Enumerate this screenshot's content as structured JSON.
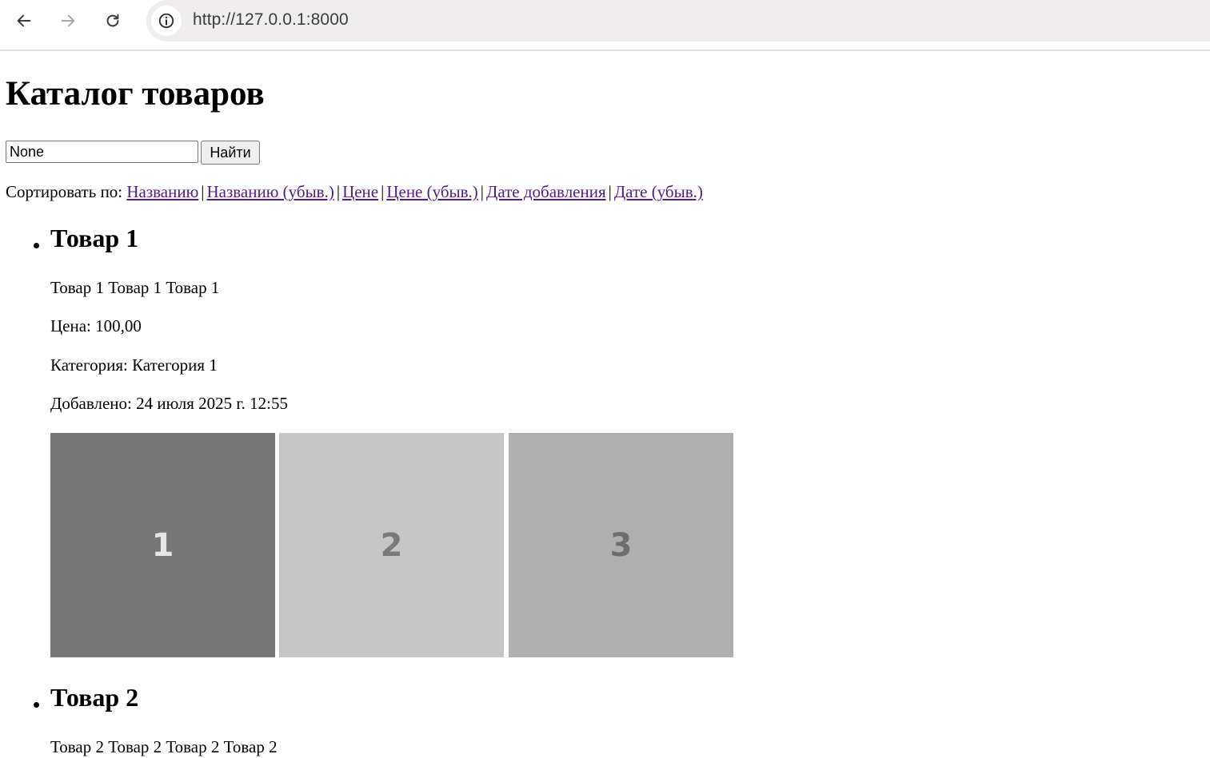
{
  "browser": {
    "url": "http://127.0.0.1:8000"
  },
  "page": {
    "title": "Каталог товаров"
  },
  "search": {
    "value": "None",
    "button_label": "Найти"
  },
  "sort": {
    "label": "Сортировать по:",
    "links": [
      "Названию",
      "Названию (убыв.)",
      "Цене",
      "Цене (убыв.)",
      "Дате добавления",
      "Дате (убыв.)"
    ],
    "separator": "|"
  },
  "products": [
    {
      "name": "Товар 1",
      "description": "Товар 1 Товар 1 Товар 1",
      "price": "Цена: 100,00",
      "category": "Категория: Категория 1",
      "added": "Добавлено: 24 июля 2025 г. 12:55",
      "images": [
        {
          "label": "1",
          "bg": "#777777",
          "fg": "#e6e6e6"
        },
        {
          "label": "2",
          "bg": "#c6c6c6",
          "fg": "#7a7a7a"
        },
        {
          "label": "3",
          "bg": "#afafaf",
          "fg": "#6e6e6e"
        }
      ]
    },
    {
      "name": "Товар 2",
      "description": "Товар 2 Товар 2 Товар 2 Товар 2"
    }
  ],
  "colors": {
    "link_visited": "#551a8b",
    "omnibox_bg": "#efedee"
  }
}
